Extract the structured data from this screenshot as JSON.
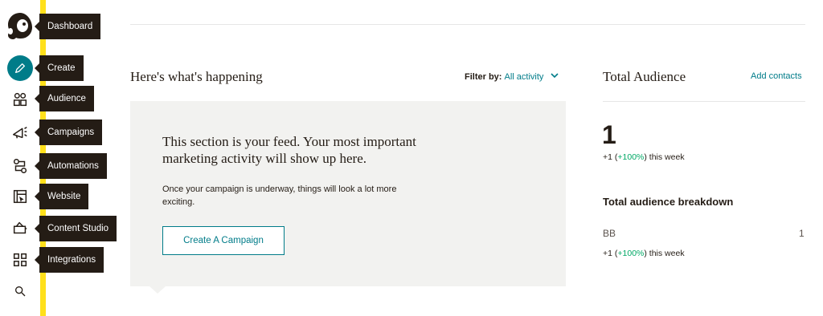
{
  "sidebar": {
    "items": [
      {
        "label": "Dashboard",
        "icon": "mailchimp-logo-icon"
      },
      {
        "label": "Create",
        "icon": "pencil-icon"
      },
      {
        "label": "Audience",
        "icon": "audience-icon"
      },
      {
        "label": "Campaigns",
        "icon": "megaphone-icon"
      },
      {
        "label": "Automations",
        "icon": "automations-icon"
      },
      {
        "label": "Website",
        "icon": "website-icon"
      },
      {
        "label": "Content Studio",
        "icon": "content-studio-icon"
      },
      {
        "label": "Integrations",
        "icon": "grid-icon"
      }
    ],
    "search_icon": "search-icon",
    "accent_color": "#ffe01b",
    "active_color": "#007c89"
  },
  "feed": {
    "title": "Here's what's happening",
    "filter_label": "Filter by:",
    "filter_value": "All activity",
    "headline": "This section is your feed. Your most important marketing activity will show up here.",
    "subtext": "Once your campaign is underway, things will look a lot more exciting.",
    "cta_label": "Create A Campaign"
  },
  "audience": {
    "title": "Total Audience",
    "add_contacts": "Add contacts",
    "count": "1",
    "delta_prefix": "+1 (",
    "delta_pct": "+100%",
    "delta_suffix": ") this week",
    "breakdown_title": "Total audience breakdown",
    "segments": [
      {
        "name": "BB",
        "count": "1",
        "delta_prefix": "+1 (",
        "delta_pct": "+100%",
        "delta_suffix": ") this week"
      }
    ]
  }
}
